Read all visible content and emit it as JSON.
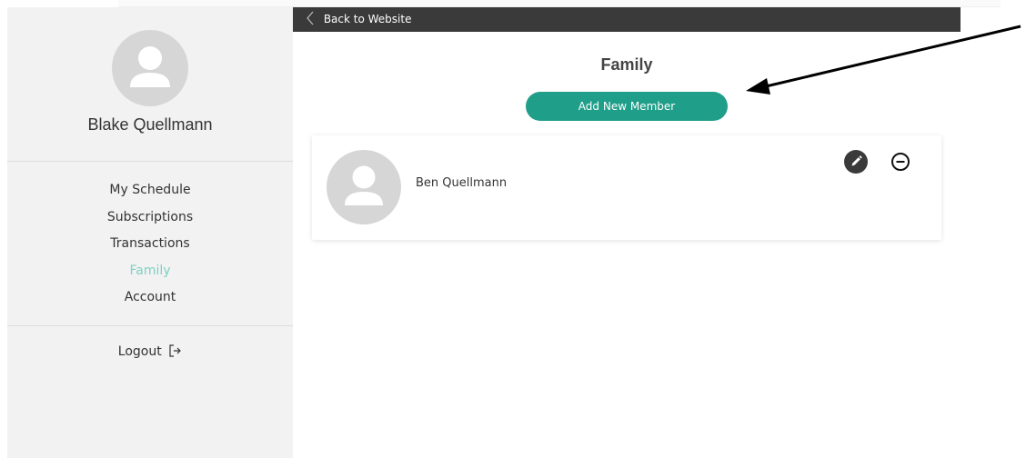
{
  "sidebar": {
    "user_name": "Blake Quellmann",
    "nav_items": [
      {
        "label": "My Schedule",
        "active": false
      },
      {
        "label": "Subscriptions",
        "active": false
      },
      {
        "label": "Transactions",
        "active": false
      },
      {
        "label": "Family",
        "active": true
      },
      {
        "label": "Account",
        "active": false
      }
    ],
    "logout_label": "Logout"
  },
  "topbar": {
    "back_label": "Back to Website"
  },
  "main": {
    "title": "Family",
    "add_button_label": "Add New Member",
    "members": [
      {
        "name": "Ben Quellmann"
      }
    ]
  },
  "colors": {
    "accent": "#1f9e89",
    "active_nav": "#7fd1c2",
    "topbar": "#3a3a3a",
    "sidebar_bg": "#f2f2f2"
  },
  "icons": [
    "user-avatar-icon",
    "logout-icon",
    "chevron-left-icon",
    "pencil-icon",
    "minus-circle-icon",
    "annotation-arrow"
  ]
}
